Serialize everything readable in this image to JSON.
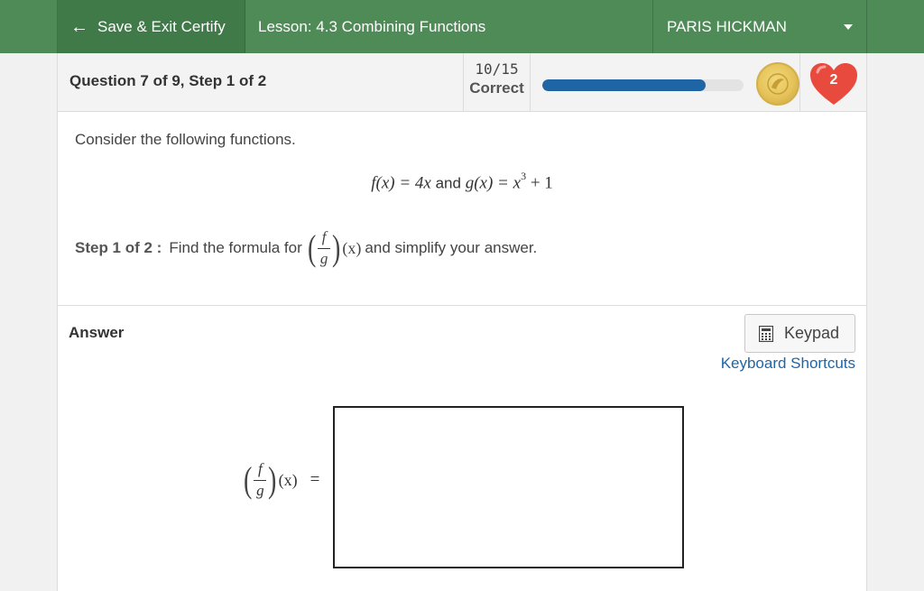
{
  "topbar": {
    "save_exit_label": "Save & Exit Certify",
    "lesson_title": "Lesson: 4.3 Combining Functions",
    "user_name": "PARIS HICKMAN"
  },
  "header": {
    "question_progress": "Question 7 of 9, Step 1 of 2",
    "score_fraction": "10/15",
    "score_label": "Correct",
    "progress_fraction": 0.81,
    "lives": "2",
    "colors": {
      "progress": "#1f65a6",
      "topbar": "#4f8b57",
      "heart": "#e84a3d",
      "coin": "#e5c35a"
    }
  },
  "question": {
    "intro": "Consider the following functions.",
    "f_def": "f(x) = 4x",
    "and_word": "and",
    "g_def_base": "g(x) = x",
    "g_def_exp": "3",
    "g_def_tail": " + 1",
    "step_label": "Step 1 of 2 :",
    "step_text_before": "Find the formula for",
    "frac_num": "f",
    "frac_den": "g",
    "of_x": "(x)",
    "step_text_after": "and simplify your answer."
  },
  "answer": {
    "label": "Answer",
    "keypad_label": "Keypad",
    "shortcuts_label": "Keyboard Shortcuts",
    "equals": "=",
    "value": ""
  }
}
